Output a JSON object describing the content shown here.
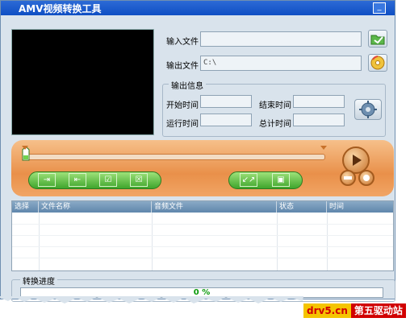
{
  "window": {
    "title": "AMV视频转换工具",
    "minimize_glyph": "_"
  },
  "files": {
    "input_label": "输入文件",
    "input_value": "",
    "output_label": "输出文件",
    "output_value": "C:\\",
    "input_browse_icon": "folder-icon",
    "output_browse_icon": "disc-icon"
  },
  "output_info": {
    "title": "输出信息",
    "start_time_label": "开始时间",
    "end_time_label": "结束时间",
    "run_time_label": "运行时间",
    "total_time_label": "总计时间",
    "start_time": "",
    "end_time": "",
    "run_time": "",
    "total_time": ""
  },
  "player": {
    "play_icon": "play-icon",
    "left_buttons": [
      "⇥",
      "⇤",
      "☑",
      "☒"
    ],
    "right_buttons": [
      "↙↗",
      "▣"
    ]
  },
  "table": {
    "columns": [
      "选择",
      "文件名称",
      "音频文件",
      "状态",
      "时间"
    ],
    "rows": []
  },
  "progress": {
    "title": "转换进度",
    "value_text": "0 %",
    "value": 0
  },
  "watermark": {
    "site": "drv5.cn",
    "name": "第五驱动站"
  },
  "colors": {
    "accent_orange": "#e9904a",
    "titlebar_blue": "#0f4fc4",
    "progress_green": "#0a9a0a"
  }
}
